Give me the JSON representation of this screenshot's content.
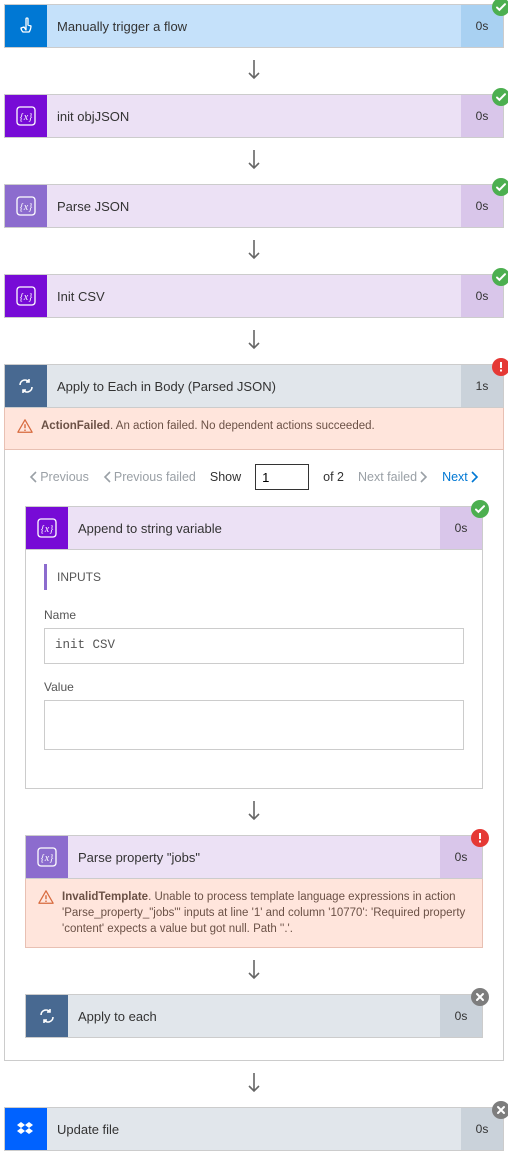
{
  "steps": {
    "trigger": {
      "title": "Manually trigger a flow",
      "time": "0s"
    },
    "init_json": {
      "title": "init objJSON",
      "time": "0s"
    },
    "parse_json": {
      "title": "Parse JSON",
      "time": "0s"
    },
    "init_csv": {
      "title": "Init CSV",
      "time": "0s"
    },
    "apply_body": {
      "title": "Apply to Each in Body (Parsed JSON)",
      "time": "1s"
    },
    "append": {
      "title": "Append to string variable",
      "time": "0s"
    },
    "parse_jobs": {
      "title": "Parse property \"jobs\"",
      "time": "0s"
    },
    "apply_each": {
      "title": "Apply to each",
      "time": "0s"
    },
    "update_file": {
      "title": "Update file",
      "time": "0s"
    }
  },
  "errors": {
    "action_failed_title": "ActionFailed",
    "action_failed_msg": ". An action failed. No dependent actions succeeded.",
    "invalid_template_title": "InvalidTemplate",
    "invalid_template_msg": ". Unable to process template language expressions in action 'Parse_property_\"jobs\"' inputs at line '1' and column '10770': 'Required property 'content' expects a value but got null. Path ''.'."
  },
  "pager": {
    "previous": "Previous",
    "previous_failed": "Previous failed",
    "show": "Show",
    "page_value": "1",
    "of_text": "of 2",
    "next_failed": "Next failed",
    "next": "Next"
  },
  "inputs_card": {
    "header": "INPUTS",
    "name_label": "Name",
    "name_value": "init CSV",
    "value_label": "Value"
  }
}
